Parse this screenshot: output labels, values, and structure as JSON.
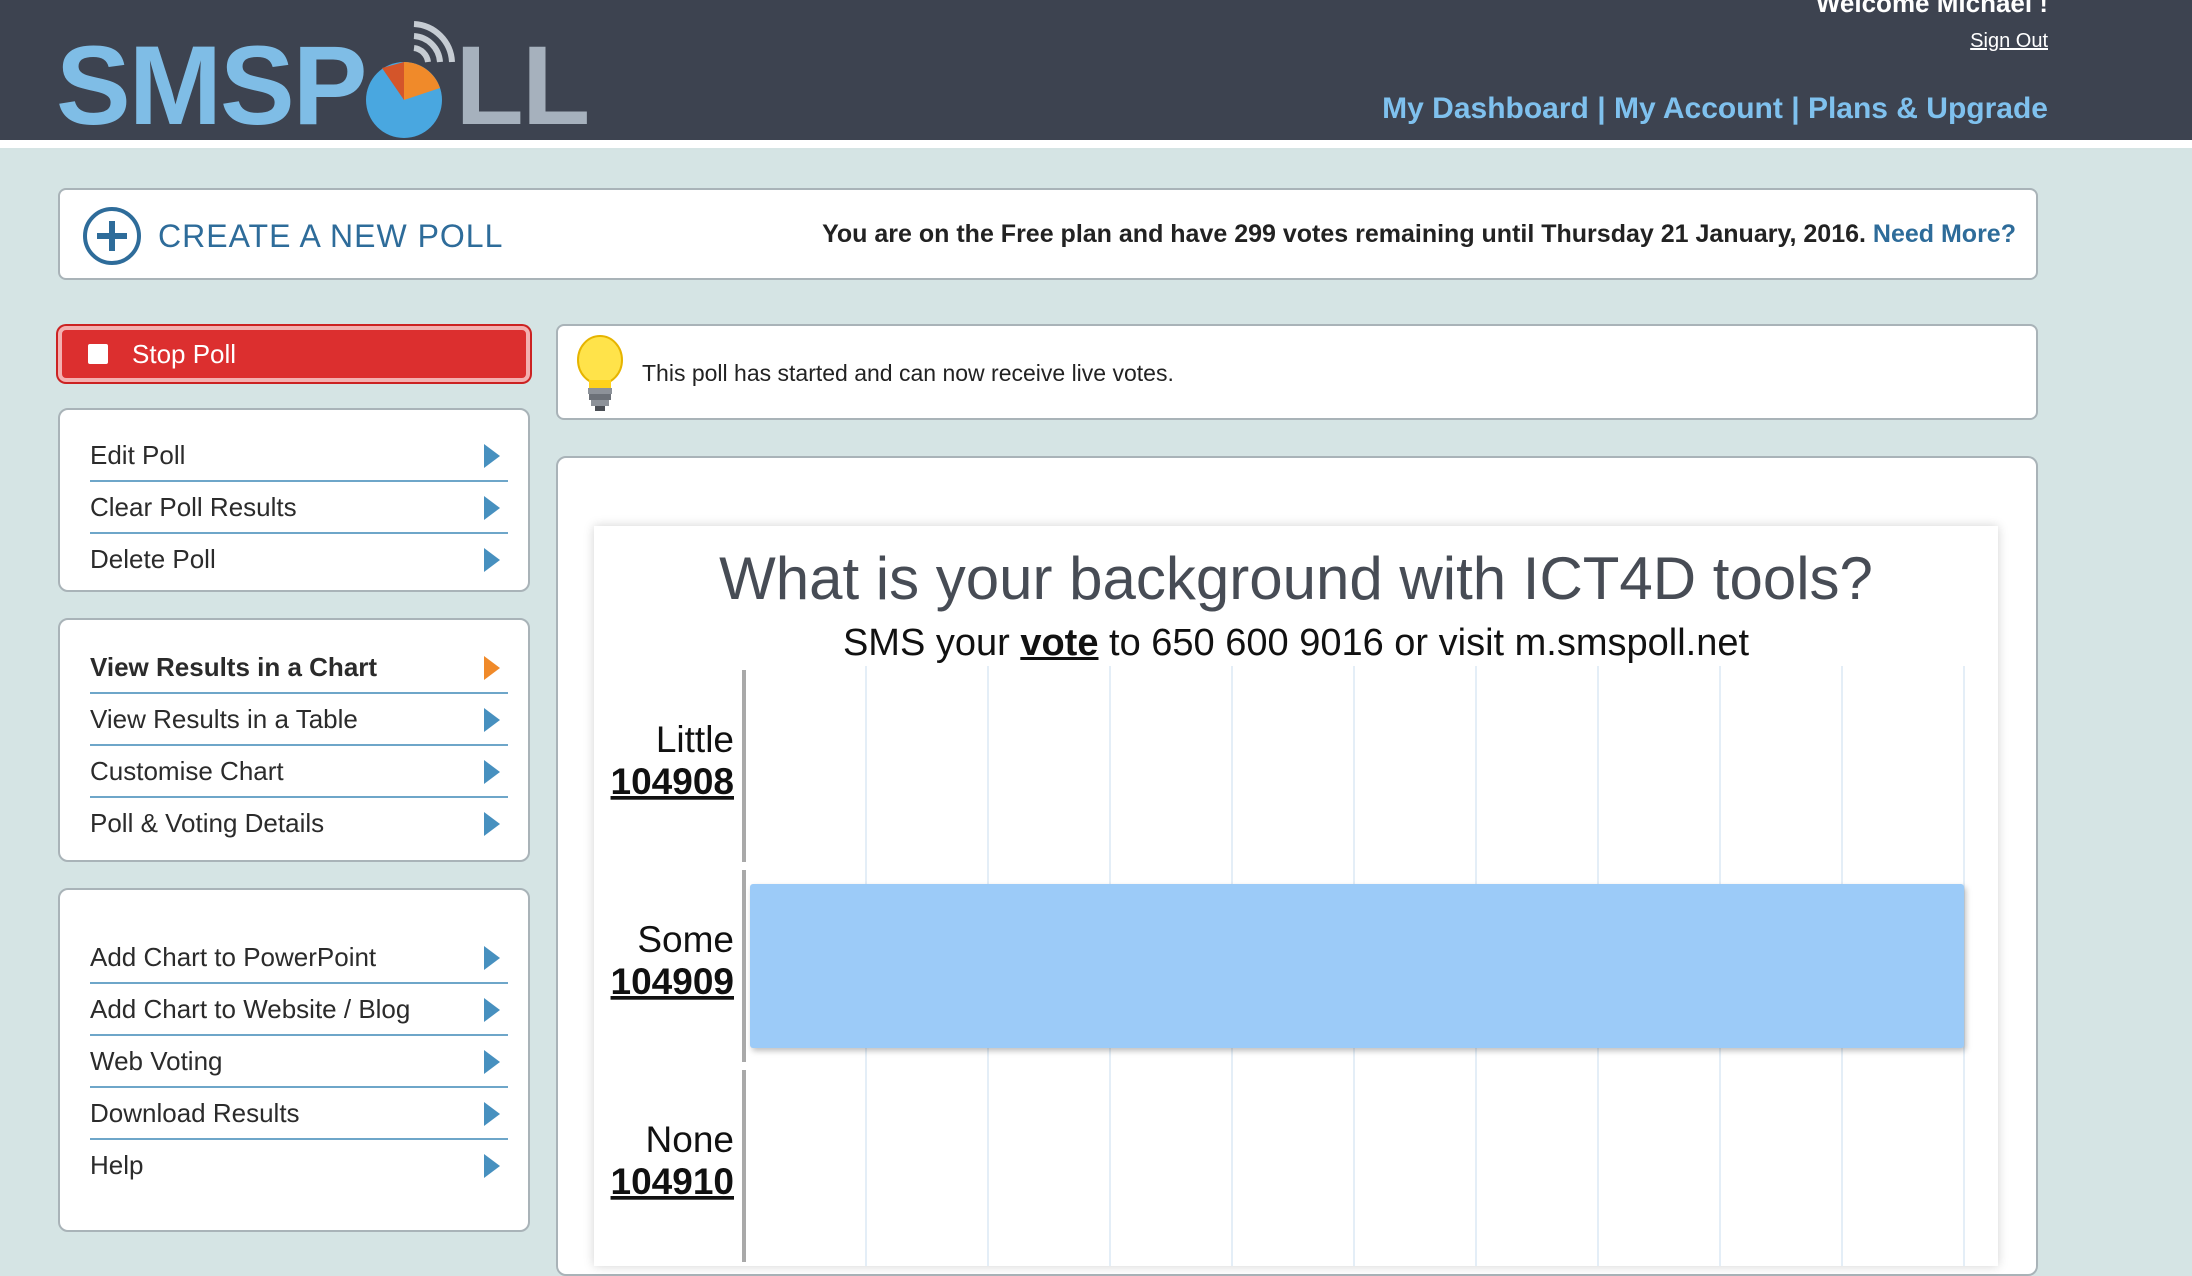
{
  "header": {
    "logo": {
      "part1": "SMSP",
      "part2": "LL"
    },
    "welcome": "Welcome Michael !",
    "sign_out": "Sign Out",
    "nav": [
      "My Dashboard",
      "My Account",
      "Plans & Upgrade"
    ],
    "nav_separator": " | "
  },
  "create_bar": {
    "button_label": "CREATE A NEW POLL",
    "plan_text": "You are on the Free plan and have 299 votes remaining until Thursday 21 January, 2016.",
    "need_more": "Need More?"
  },
  "stop_poll": {
    "label": "Stop Poll"
  },
  "sidebar": {
    "group1": [
      {
        "label": "Edit Poll"
      },
      {
        "label": "Clear Poll Results"
      },
      {
        "label": "Delete Poll"
      }
    ],
    "group2": [
      {
        "label": "View Results in a Chart",
        "active": true
      },
      {
        "label": "View Results in a Table"
      },
      {
        "label": "Customise Chart"
      },
      {
        "label": "Poll & Voting Details"
      }
    ],
    "group3": [
      {
        "label": "Add Chart to PowerPoint"
      },
      {
        "label": "Add Chart to Website / Blog"
      },
      {
        "label": "Web Voting"
      },
      {
        "label": "Download Results"
      },
      {
        "label": "Help"
      }
    ]
  },
  "info": {
    "message": "This poll has started and can now receive live votes."
  },
  "colors": {
    "header_bg": "#3d4350",
    "page_bg": "#d5e4e4",
    "link_blue": "#2e6c9a",
    "stop_red": "#dc2f2f",
    "bar_fill": "#9ccbf8",
    "arrow_blue": "#4790bf",
    "arrow_active": "#f08a2a"
  },
  "chart_data": {
    "type": "bar",
    "orientation": "horizontal",
    "title": "What is your background with ICT4D tools?",
    "subtitle": {
      "before": "SMS your ",
      "keyword": "vote",
      "after": " to 650 600 9016 or visit m.smspoll.net"
    },
    "categories": [
      "Little",
      "Some",
      "None"
    ],
    "codes": [
      "104908",
      "104909",
      "104910"
    ],
    "values": [
      0,
      1,
      0
    ],
    "xlim": [
      0,
      1
    ],
    "grid": true
  }
}
